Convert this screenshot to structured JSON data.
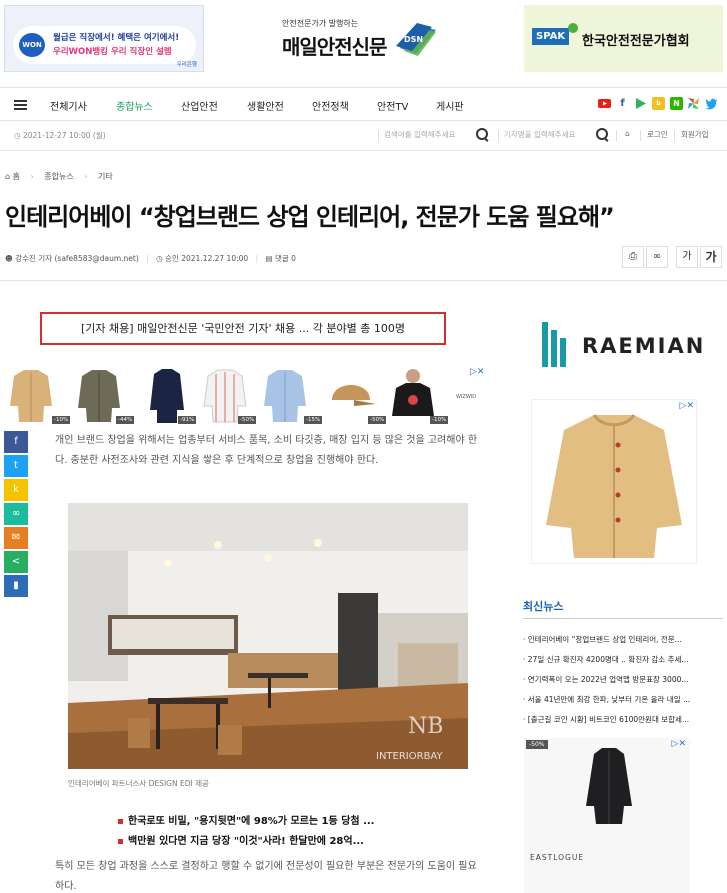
{
  "ads": {
    "left": {
      "line1": "월급은 직장에서! 혜택은 여기에서!",
      "line2": "우리WON뱅킹 우리 직장인 설렘",
      "bank": "우리은행",
      "logo": "WON"
    },
    "right": {
      "badge": "SPAK",
      "text": "한국안전전문가협회"
    }
  },
  "site": {
    "tagline": "안전전문가가 발행하는",
    "name": "매일안전신문",
    "logo_mark": "DSN"
  },
  "nav": {
    "items": [
      "전체기사",
      "종합뉴스",
      "산업안전",
      "생활안전",
      "안전정책",
      "안전TV",
      "게시판"
    ],
    "active_index": 1
  },
  "subbar": {
    "date": "2021-12-27 10:00 (월)",
    "search1_placeholder": "검색어를 입력해주세요",
    "search2_placeholder": "기자명을 입력해주세요",
    "login": "로그인",
    "signup": "회원가입"
  },
  "breadcrumb": {
    "home": "홈",
    "section": "종합뉴스",
    "sub": "기타"
  },
  "article": {
    "title": "인테리어베이 “창업브랜드 상업 인테리어, 전문가 도움 필요해”",
    "author": "강수진 기자 (safe8583@daum.net)",
    "approved": "승인 2021.12.27 10:00",
    "comments": "댓글 0",
    "recruit": "[기자 채용] 매일안전신문 '국민안전 기자' 채용 ... 각 분야별 총 100명",
    "para1": "개인 브랜드 창업을 위해서는 업종부터 서비스 품목, 소비 타깃층, 매장 입지 등 많은 것을 고려해야 한다. 충분한 사전조사와 관련 지식을 쌓은 후 단계적으로 창업을 진행해야 한다.",
    "caption": "인테리어베이 파트너스사 DESIGN EDI 제공",
    "hot1": "한국로또 비밀, \"용지뒷면\"에 98%가 모르는 1등 당첨 ...",
    "hot2": "백만원 있다면 지금 당장 \"이것\"사라! 한달만에 28억...",
    "para2": "특히 모든 창업 과정을 스스로 결정하고 행할 수 없기에 전문성이 필요한 부분은 전문가의 도움이 필요하다.",
    "watermark": "INTERIORBAY",
    "watermark_mark": "NB"
  },
  "font_sizes": [
    "가",
    "가"
  ],
  "products": {
    "discounts": [
      "-10%",
      "-44%",
      "-91%",
      "-50%",
      "-15%",
      "-50%",
      "-10%"
    ],
    "brand": "WIZWID"
  },
  "sidebar": {
    "brand_ad": "RAEMIAN",
    "latest_title": "최신뉴스",
    "latest": [
      "인테리어베이 “창업브랜드 상업 인테리어, 전문...",
      "27일 신규 확진자 4200명대 .. 확진자 감소 추세...",
      "연기력폭이 오는 2022년 업역맵 방문표장 3000...",
      "서울 41년만에 최강 한파, 낮부터 기온 올라 내일 ...",
      "[출근길 코인 시황] 비트코인 6100만원대 보합세..."
    ],
    "bottom_ad": {
      "discount": "-50%",
      "brand": "EASTLOGUE"
    }
  }
}
